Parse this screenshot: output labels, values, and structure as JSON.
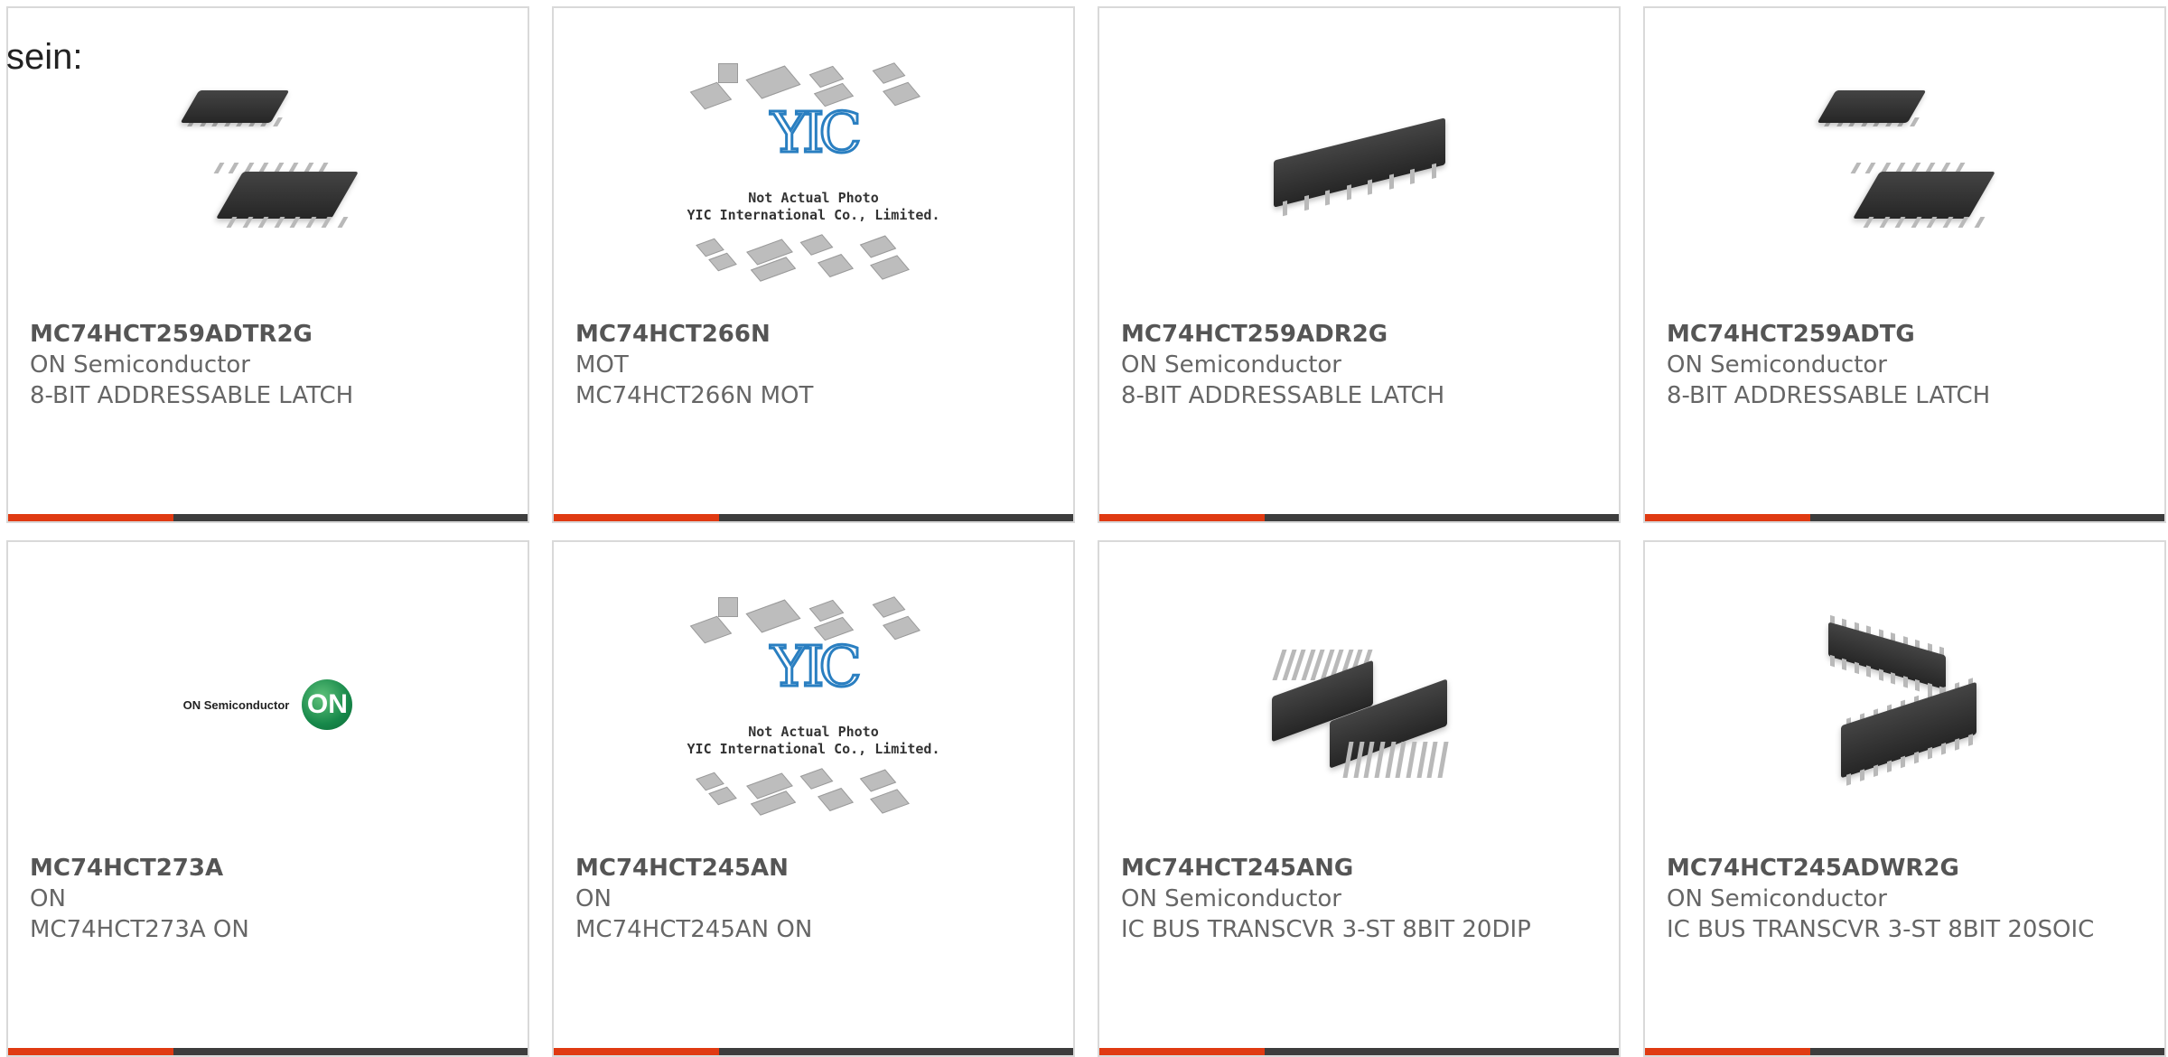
{
  "intro_text": "sein:",
  "products": [
    {
      "part_number": "MC74HCT259ADTR2G",
      "manufacturer": "ON Semiconductor",
      "description": "8-BIT ADDRESSABLE LATCH",
      "image": "tssop-package-photo"
    },
    {
      "part_number": "MC74HCT266N",
      "manufacturer": "MOT",
      "description": "MC74HCT266N MOT",
      "image": "yic-placeholder-photo",
      "image_text": {
        "line1": "Not Actual Photo",
        "line2": "YIC International Co., Limited.",
        "logo": "YIC"
      }
    },
    {
      "part_number": "MC74HCT259ADR2G",
      "manufacturer": "ON Semiconductor",
      "description": "8-BIT ADDRESSABLE LATCH",
      "image": "soic-package-photo"
    },
    {
      "part_number": "MC74HCT259ADTG",
      "manufacturer": "ON Semiconductor",
      "description": "8-BIT ADDRESSABLE LATCH",
      "image": "tssop-package-photo"
    },
    {
      "part_number": "MC74HCT273A",
      "manufacturer": "ON",
      "description": "MC74HCT273A ON",
      "image": "on-semiconductor-logo",
      "image_text": {
        "brand": "ON Semiconductor",
        "mark": "ON"
      }
    },
    {
      "part_number": "MC74HCT245AN",
      "manufacturer": "ON",
      "description": "MC74HCT245AN ON",
      "image": "yic-placeholder-photo",
      "image_text": {
        "line1": "Not Actual Photo",
        "line2": "YIC International Co., Limited.",
        "logo": "YIC"
      }
    },
    {
      "part_number": "MC74HCT245ANG",
      "manufacturer": "ON Semiconductor",
      "description": "IC BUS TRANSCVR 3-ST 8BIT 20DIP",
      "image": "dip-package-photo"
    },
    {
      "part_number": "MC74HCT245ADWR2G",
      "manufacturer": "ON Semiconductor",
      "description": "IC BUS TRANSCVR 3-ST 8BIT 20SOIC",
      "image": "soic-wide-package-photo"
    }
  ],
  "colors": {
    "accent": "#e03a12",
    "bar": "#3d3d3d",
    "text": "#666666",
    "border": "#d9d9d9"
  }
}
